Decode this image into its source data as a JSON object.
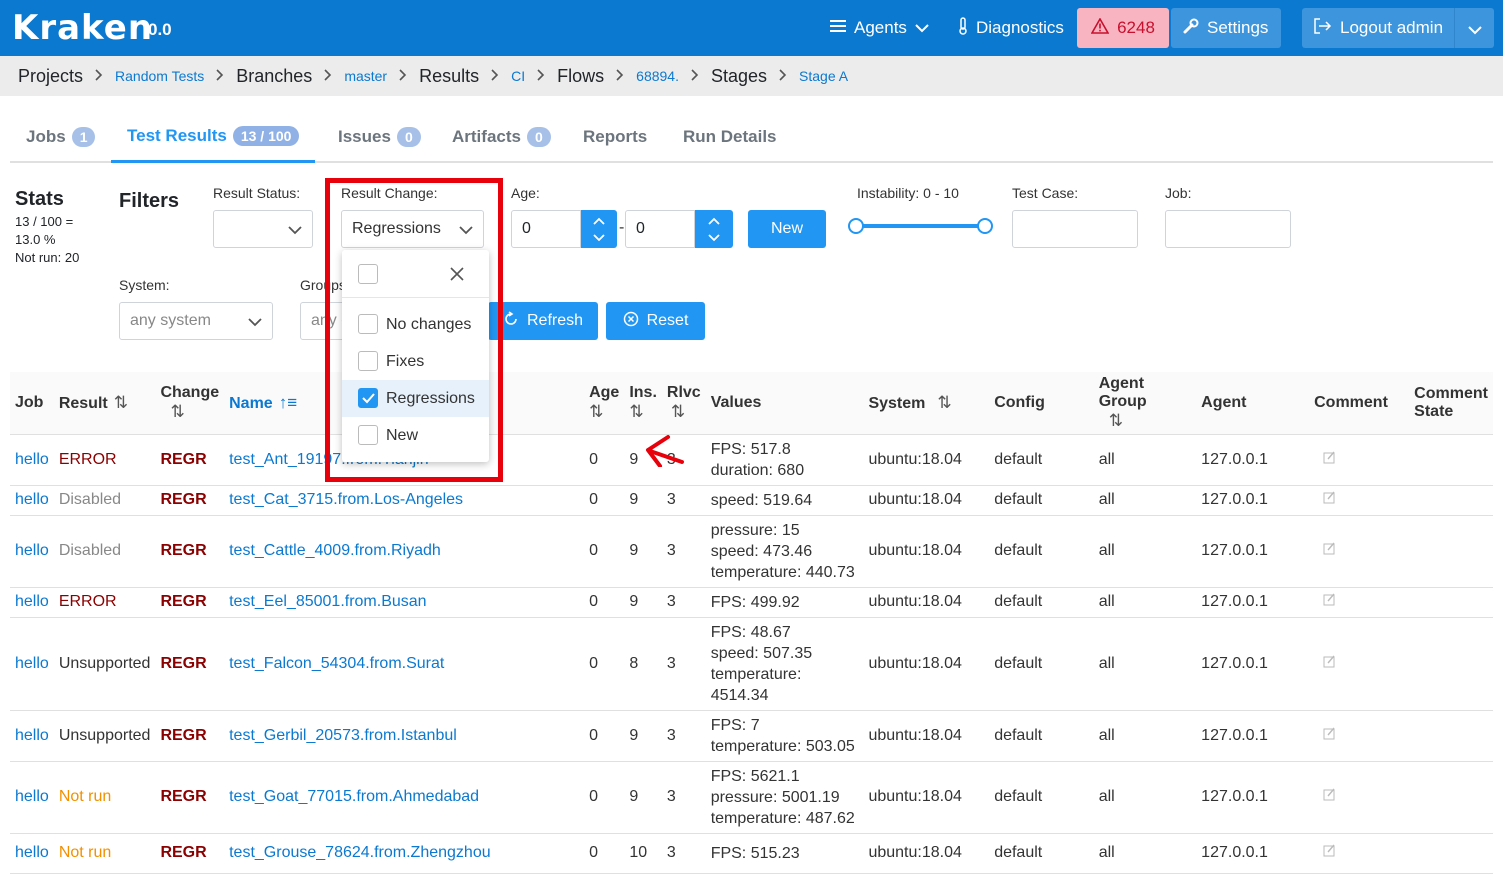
{
  "app": {
    "logo": "Kraken",
    "version": "0.0"
  },
  "topnav": {
    "agents": "Agents",
    "diagnostics": "Diagnostics",
    "alerts_count": "6248",
    "settings": "Settings",
    "logout": "Logout admin"
  },
  "breadcrumb": [
    {
      "label": "Projects",
      "link": false
    },
    {
      "label": "Random Tests",
      "link": true
    },
    {
      "label": "Branches",
      "link": false
    },
    {
      "label": "master",
      "link": true
    },
    {
      "label": "Results",
      "link": false
    },
    {
      "label": "CI",
      "link": true
    },
    {
      "label": "Flows",
      "link": false
    },
    {
      "label": "68894.",
      "link": true
    },
    {
      "label": "Stages",
      "link": false
    },
    {
      "label": "Stage A",
      "link": true
    }
  ],
  "tabs": [
    {
      "label": "Jobs",
      "badge": "1"
    },
    {
      "label": "Test Results",
      "badge": "13 / 100"
    },
    {
      "label": "Issues",
      "badge": "0"
    },
    {
      "label": "Artifacts",
      "badge": "0"
    },
    {
      "label": "Reports",
      "badge": ""
    },
    {
      "label": "Run Details",
      "badge": ""
    }
  ],
  "stats": {
    "title": "Stats",
    "line1": "13 / 100 =",
    "line2": "13.0 %",
    "line3": "Not run: 20"
  },
  "filters": {
    "title": "Filters",
    "result_status_label": "Result Status:",
    "result_change_label": "Result Change:",
    "result_change_value": "Regressions",
    "age_label": "Age:",
    "age_from": "0",
    "age_to": "0",
    "age_dash": "-",
    "new_button": "New",
    "instability_label": "Instability: 0 - 10",
    "test_case_label": "Test Case:",
    "job_label": "Job:",
    "system_label": "System:",
    "system_value": "any system",
    "groups_label": "Groups",
    "groups_value": "any g",
    "refresh_button": "Refresh",
    "reset_button": "Reset"
  },
  "dropdown": {
    "options": [
      {
        "label": "No changes",
        "checked": false
      },
      {
        "label": "Fixes",
        "checked": false
      },
      {
        "label": "Regressions",
        "checked": true
      },
      {
        "label": "New",
        "checked": false
      }
    ]
  },
  "table": {
    "headers": {
      "job": "Job",
      "result": "Result",
      "change": "Change",
      "name": "Name",
      "age": "Age",
      "ins": "Ins.",
      "rlvc": "Rlvc",
      "values": "Values",
      "system": "System",
      "config": "Config",
      "agent_group": "Agent Group",
      "agent": "Agent",
      "comment": "Comment",
      "comment_state_1": "Comment",
      "comment_state_2": "State"
    },
    "rows": [
      {
        "job": "hello",
        "result": "ERROR",
        "result_class": "res-error",
        "change": "REGR",
        "name": "test_Ant_19197.from.Tianjin",
        "age": "0",
        "ins": "9",
        "rlvc": "3",
        "values": [
          "FPS: 517.8",
          "duration: 680"
        ],
        "system": "ubuntu:18.04",
        "config": "default",
        "group": "all",
        "agent": "127.0.0.1"
      },
      {
        "job": "hello",
        "result": "Disabled",
        "result_class": "res-disabled",
        "change": "REGR",
        "name": "test_Cat_3715.from.Los-Angeles",
        "age": "0",
        "ins": "9",
        "rlvc": "3",
        "values": [
          "speed: 519.64"
        ],
        "system": "ubuntu:18.04",
        "config": "default",
        "group": "all",
        "agent": "127.0.0.1"
      },
      {
        "job": "hello",
        "result": "Disabled",
        "result_class": "res-disabled",
        "change": "REGR",
        "name": "test_Cattle_4009.from.Riyadh",
        "age": "0",
        "ins": "9",
        "rlvc": "3",
        "values": [
          "pressure: 15",
          "speed: 473.46",
          "temperature: 440.73"
        ],
        "system": "ubuntu:18.04",
        "config": "default",
        "group": "all",
        "agent": "127.0.0.1"
      },
      {
        "job": "hello",
        "result": "ERROR",
        "result_class": "res-error",
        "change": "REGR",
        "name": "test_Eel_85001.from.Busan",
        "age": "0",
        "ins": "9",
        "rlvc": "3",
        "values": [
          "FPS: 499.92"
        ],
        "system": "ubuntu:18.04",
        "config": "default",
        "group": "all",
        "agent": "127.0.0.1"
      },
      {
        "job": "hello",
        "result": "Unsupported",
        "result_class": "res-unsup",
        "change": "REGR",
        "name": "test_Falcon_54304.from.Surat",
        "age": "0",
        "ins": "8",
        "rlvc": "3",
        "values": [
          "FPS: 48.67",
          "speed: 507.35",
          "temperature: 4514.34"
        ],
        "system": "ubuntu:18.04",
        "config": "default",
        "group": "all",
        "agent": "127.0.0.1"
      },
      {
        "job": "hello",
        "result": "Unsupported",
        "result_class": "res-unsup",
        "change": "REGR",
        "name": "test_Gerbil_20573.from.Istanbul",
        "age": "0",
        "ins": "9",
        "rlvc": "3",
        "values": [
          "FPS: 7",
          "temperature: 503.05"
        ],
        "system": "ubuntu:18.04",
        "config": "default",
        "group": "all",
        "agent": "127.0.0.1"
      },
      {
        "job": "hello",
        "result": "Not run",
        "result_class": "res-notrun",
        "change": "REGR",
        "name": "test_Goat_77015.from.Ahmedabad",
        "age": "0",
        "ins": "9",
        "rlvc": "3",
        "values": [
          "FPS: 5621.1",
          "pressure: 5001.19",
          "temperature: 487.62"
        ],
        "system": "ubuntu:18.04",
        "config": "default",
        "group": "all",
        "agent": "127.0.0.1"
      },
      {
        "job": "hello",
        "result": "Not run",
        "result_class": "res-notrun",
        "change": "REGR",
        "name": "test_Grouse_78624.from.Zhengzhou",
        "age": "0",
        "ins": "10",
        "rlvc": "3",
        "values": [
          "FPS: 515.23"
        ],
        "system": "ubuntu:18.04",
        "config": "default",
        "group": "all",
        "agent": "127.0.0.1"
      }
    ]
  },
  "colors": {
    "brand": "#0b79d0",
    "accent": "#2196f3",
    "alert_bg": "#f8b4c0",
    "alert_text": "#c8102e",
    "highlight": "#e8000b",
    "error": "#8b0000",
    "notrun": "#f29000"
  }
}
